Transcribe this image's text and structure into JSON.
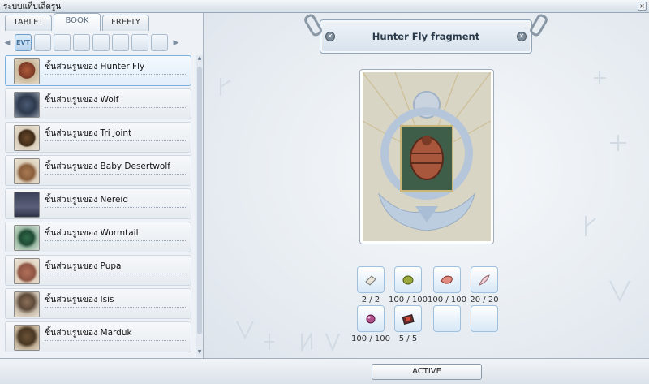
{
  "window": {
    "title": "ระบบแท็บเล็ตรูน",
    "close_glyph": "×"
  },
  "tabs": [
    {
      "label": "TABLET"
    },
    {
      "label": "BOOK"
    },
    {
      "label": "FREELY"
    }
  ],
  "active_tab": "BOOK",
  "categories": {
    "left_arrow": "◀",
    "right_arrow": "▶",
    "selected_label": "EVT",
    "total_buttons": 8
  },
  "rune_list": [
    {
      "name": "ชิ้นส่วนรูนของ Hunter Fly",
      "selected": true
    },
    {
      "name": "ชิ้นส่วนรูนของ Wolf"
    },
    {
      "name": "ชิ้นส่วนรูนของ Tri Joint"
    },
    {
      "name": "ชิ้นส่วนรูนของ Baby Desertwolf"
    },
    {
      "name": "ชิ้นส่วนรูนของ Nereid"
    },
    {
      "name": "ชิ้นส่วนรูนของ Wormtail"
    },
    {
      "name": "ชิ้นส่วนรูนของ Pupa"
    },
    {
      "name": "ชิ้นส่วนรูนของ Isis"
    },
    {
      "name": "ชิ้นส่วนรูนของ Marduk"
    }
  ],
  "detail": {
    "title": "Hunter Fly fragment",
    "materials": [
      {
        "icon": "paper-icon",
        "qty": "2 / 2"
      },
      {
        "icon": "green-seed-icon",
        "qty": "100 / 100"
      },
      {
        "icon": "meat-icon",
        "qty": "100 / 100"
      },
      {
        "icon": "feather-icon",
        "qty": "20 / 20"
      },
      {
        "icon": "purple-orb-icon",
        "qty": "100 / 100"
      },
      {
        "icon": "card-album-icon",
        "qty": "5 / 5"
      }
    ]
  },
  "footer": {
    "active_label": "ACTIVE"
  },
  "colors": {
    "accent": "#7fb0dc",
    "panel_bg": "#eef1f5"
  }
}
